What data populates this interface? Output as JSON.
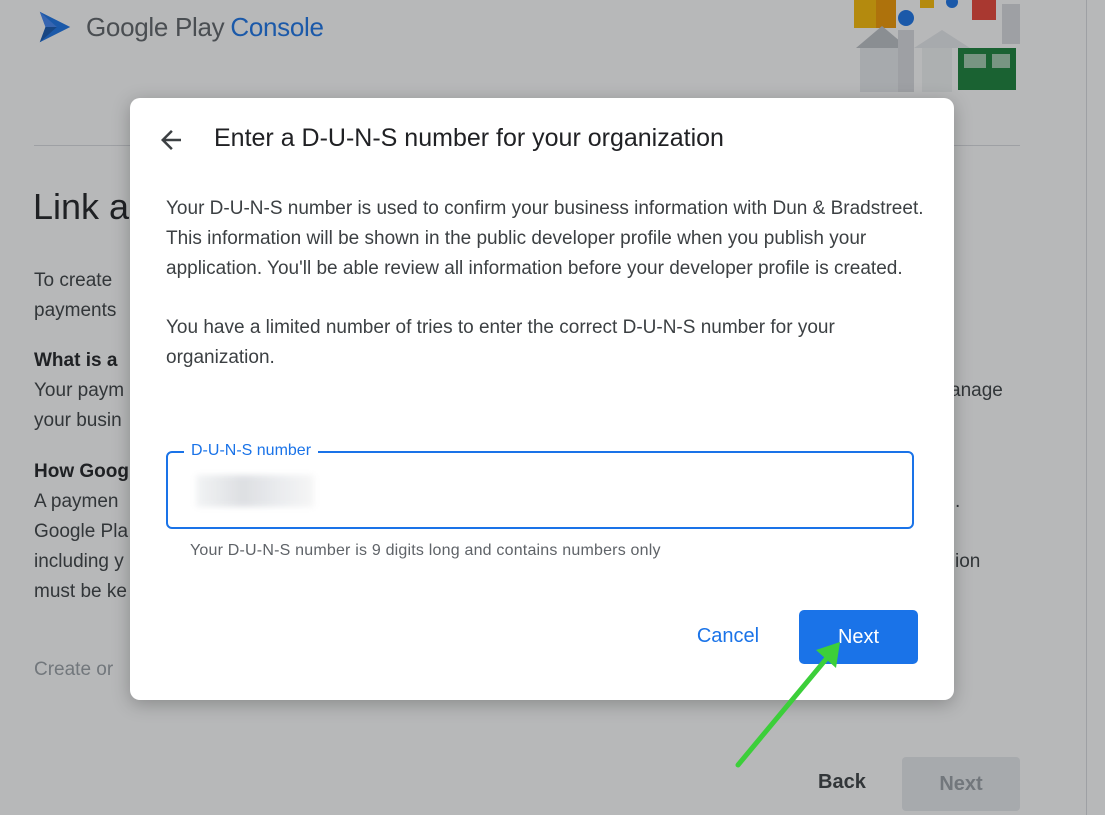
{
  "header": {
    "brand_google": "Google Play",
    "brand_console": "Console"
  },
  "background": {
    "title": "Link a",
    "para1_line1": "To create",
    "para1_line2": "payments",
    "section1_heading": "What is a",
    "section1_line1": "Your paym",
    "section1_line1_right": "anage",
    "section1_line2": "your busin",
    "section2_heading": "How Goog",
    "section2_line1": "A paymen",
    "section2_line1_right": ".",
    "section2_line2": "Google Pla",
    "section2_line3": "including y",
    "section2_line3_right": "ion",
    "section2_line4": "must be ke",
    "link_text": "Create or",
    "back_label": "Back",
    "next_label": "Next"
  },
  "dialog": {
    "title": "Enter a D-U-N-S number for your organization",
    "paragraph1": "Your D-U-N-S number is used to confirm your business information with Dun & Bradstreet. This information will be shown in the public developer profile when you publish your application. You'll be able review all information before your developer profile is created.",
    "paragraph2": "You have a limited number of tries to enter the correct D-U-N-S number for your organization.",
    "field": {
      "label": "D-U-N-S number",
      "value": "",
      "helper": "Your D-U-N-S number is 9 digits long and contains numbers only"
    },
    "cancel_label": "Cancel",
    "next_label": "Next"
  },
  "colors": {
    "accent": "#1a73e8",
    "annotation_arrow": "#3ccf3a",
    "text_primary": "#202124",
    "text_secondary": "#5f6368"
  },
  "icons": {
    "logo": "play-console-logo-icon",
    "back": "arrow-back-icon",
    "annotation": "green-pointer-arrow-icon"
  }
}
